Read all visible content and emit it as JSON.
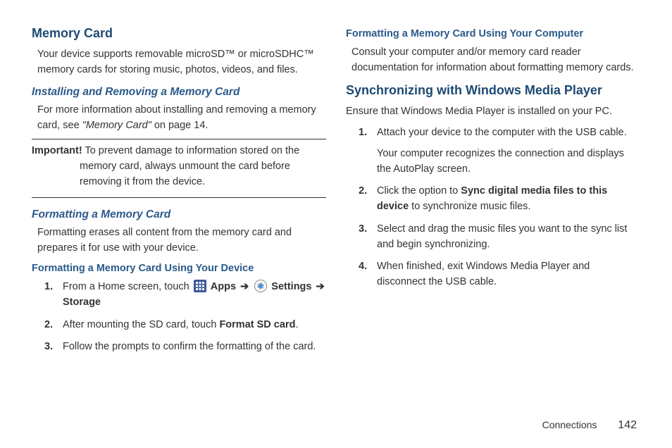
{
  "col1": {
    "h1": "Memory Card",
    "intro": "Your device supports removable microSD™ or microSDHC™ memory cards for storing music, photos, videos, and files.",
    "h2_install": "Installing and Removing a Memory Card",
    "install_p1_a": "For more information about installing and removing a memory card, see ",
    "install_p1_ref": "\"Memory Card\"",
    "install_p1_b": " on page 14.",
    "important_label": "Important!",
    "important_text": " To prevent damage to information stored on the memory card, always unmount the card before removing it from the device.",
    "h2_format": "Formatting a Memory Card",
    "format_p": "Formatting erases all content from the memory card and prepares it for use with your device.",
    "h3_device": "Formatting a Memory Card Using Your Device",
    "steps": [
      {
        "num": "1.",
        "a": "From a Home screen, touch ",
        "apps": " Apps ",
        "arrow1": "➔",
        "settings": " Settings ",
        "arrow2": "➔",
        "storage": " Storage"
      },
      {
        "num": "2.",
        "a": "After mounting the SD card, touch ",
        "bold": "Format SD card",
        "b": "."
      },
      {
        "num": "3.",
        "a": "Follow the prompts to confirm the formatting of the card."
      }
    ]
  },
  "col2": {
    "h3_computer": "Formatting a Memory Card Using Your Computer",
    "computer_p": "Consult your computer and/or memory card reader documentation for information about formatting memory cards.",
    "h1_sync": "Synchronizing with Windows Media Player",
    "sync_intro": "Ensure that Windows Media Player is installed on your PC.",
    "steps": [
      {
        "num": "1.",
        "a": "Attach your device to the computer with the USB cable.",
        "b": "Your computer recognizes the connection and displays the AutoPlay screen."
      },
      {
        "num": "2.",
        "a": "Click the option to ",
        "bold": "Sync digital media files to this device",
        "c": " to synchronize music files."
      },
      {
        "num": "3.",
        "a": "Select and drag the music files you want to the sync list and begin synchronizing."
      },
      {
        "num": "4.",
        "a": "When finished, exit Windows Media Player and disconnect the USB cable."
      }
    ]
  },
  "footer": {
    "section": "Connections",
    "page": "142"
  }
}
